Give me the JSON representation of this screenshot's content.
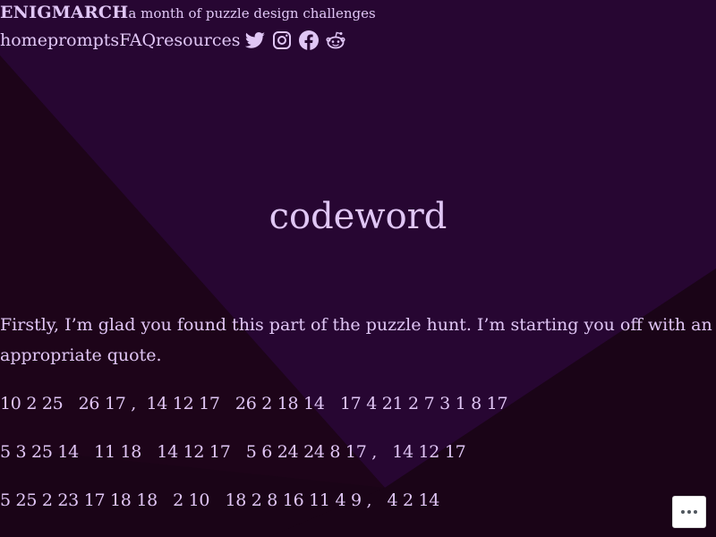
{
  "header": {
    "site_title": "ENIGMARCH",
    "tagline": "a month of puzzle design challenges",
    "nav": [
      {
        "label": "home"
      },
      {
        "label": "prompts"
      },
      {
        "label": "FAQ"
      },
      {
        "label": "resources"
      }
    ],
    "social_icons": [
      "twitter-icon",
      "instagram-icon",
      "facebook-icon",
      "reddit-icon"
    ]
  },
  "page": {
    "title": "codeword",
    "intro": "Firstly, I’m glad you found this part of the puzzle hunt. I’m starting you off with an appropriate quote.",
    "code_lines": [
      "10 2 25   26 17 ,  14 12 17   26 2 18 14   17 4 21 2 7 3 1 8 17",
      "5 3 25 14   11 18   14 12 17   5 6 24 24 8 17 ,   14 12 17",
      "5 25 2 23 17 18 18   2 10   18 2 8 16 11 4 9 ,   4 2 14"
    ]
  },
  "controls": {
    "more_button_icon": "more-dots-icon"
  },
  "colors": {
    "background": "#1a0417",
    "panel": "#270632",
    "panel_light": "#2f0a3e",
    "text": "#e0c6f5",
    "button_bg": "#ffffff"
  }
}
